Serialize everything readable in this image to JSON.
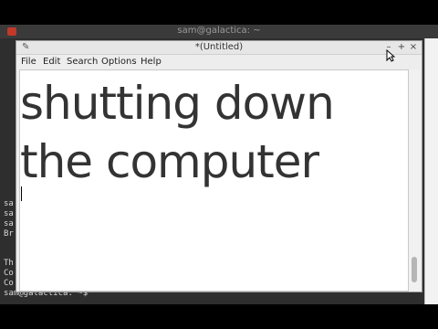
{
  "terminal": {
    "title": "sam@galactica: ~",
    "lines": [
      "sa",
      "sa",
      "sa",
      "Br",
      "Th",
      "Co",
      "Co",
      "sam@galactica: ~$"
    ]
  },
  "editor": {
    "title": "*(Untitled)",
    "window_buttons": {
      "minimize": "–",
      "maximize": "+",
      "close": "×"
    },
    "menu": [
      "File",
      "Edit",
      "Search",
      "Options",
      "Help"
    ],
    "content_lines": [
      "shutting down",
      "the computer"
    ]
  },
  "colors": {
    "terminal_bg": "#2e2e2e",
    "close_button": "#c0392b",
    "text": "#333333"
  }
}
